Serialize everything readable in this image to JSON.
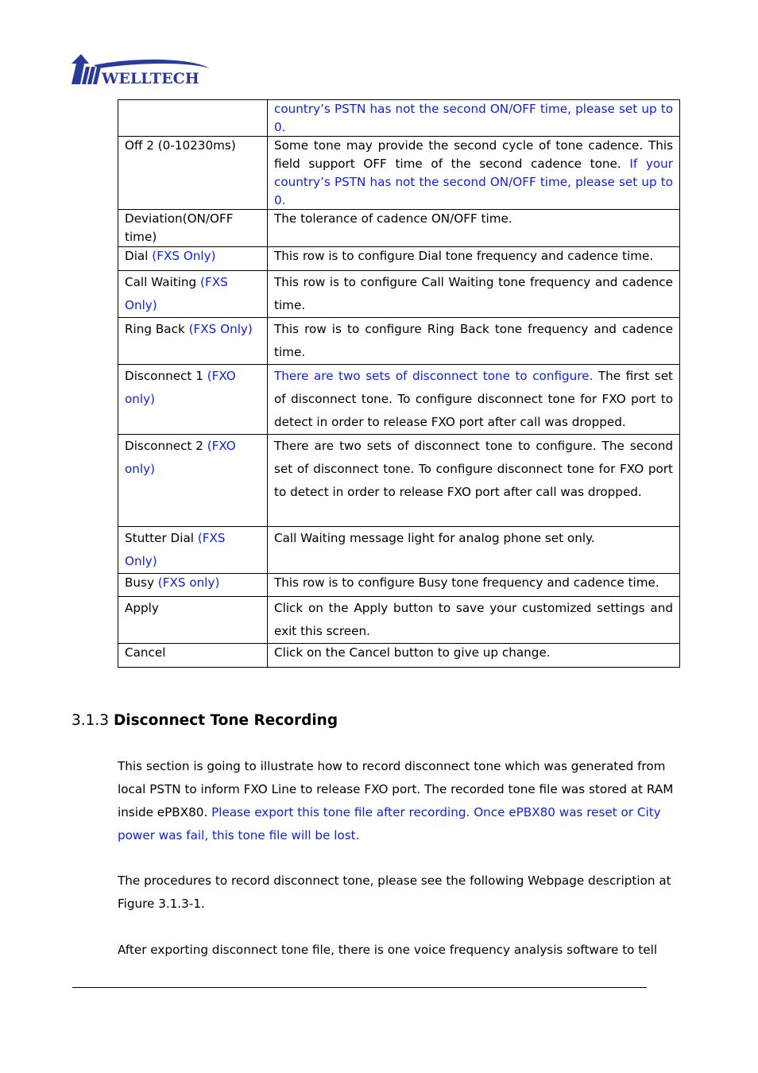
{
  "header": {
    "logo_text": "WELLTECH",
    "brand_color": "#2a3a9a"
  },
  "colors": {
    "highlight": "#0b1ff0",
    "text": "#000000"
  },
  "table": {
    "rows": [
      {
        "field": "",
        "field_note": "",
        "desc_plain": "",
        "desc_blue": "country’s PSTN has not the second ON/OFF time, please set up to 0.",
        "desc_after": ""
      },
      {
        "field": "Off 2 (0-10230ms)",
        "field_note": "",
        "desc_plain": "Some tone may provide the second cycle of tone cadence. This field support OFF time of the second cadence tone. ",
        "desc_blue": "If your country’s PSTN has not the second ON/OFF time, please set up to 0.",
        "desc_after": ""
      },
      {
        "field": "Deviation(ON/OFF time)",
        "field_note": "",
        "desc_plain": "The tolerance of cadence ON/OFF time.",
        "desc_blue": "",
        "desc_after": ""
      },
      {
        "field": "Dial ",
        "field_note": "(FXS Only)",
        "desc_plain": "This row is to configure Dial tone frequency and cadence time.",
        "desc_blue": "",
        "desc_after": ""
      },
      {
        "field": "Call Waiting ",
        "field_note": "(FXS Only)",
        "desc_plain": "This row is to configure Call Waiting tone frequency and cadence time.",
        "desc_blue": "",
        "desc_after": ""
      },
      {
        "field": "Ring Back ",
        "field_note": "(FXS Only)",
        "desc_plain": "This row is to configure Ring Back tone frequency and cadence time.",
        "desc_blue": "",
        "desc_after": ""
      },
      {
        "field": "Disconnect 1 ",
        "field_note": "(FXO only)",
        "desc_plain": "",
        "desc_blue": "There are two sets of disconnect tone to configure.",
        "desc_after": " The first set of disconnect tone. To configure disconnect tone for FXO port to detect in order to release FXO port after call was dropped."
      },
      {
        "field": "Disconnect 2 ",
        "field_note": "(FXO only)",
        "desc_plain": "There are two sets of disconnect tone to configure. The second set of disconnect tone. To configure disconnect tone for FXO port to detect in order to release FXO port after call was dropped.",
        "desc_blue": "",
        "desc_after": ""
      },
      {
        "field": "Stutter Dial ",
        "field_note": "(FXS Only)",
        "desc_plain": "Call Waiting message light for analog phone set only.",
        "desc_blue": "",
        "desc_after": ""
      },
      {
        "field": "Busy ",
        "field_note": "(FXS only)",
        "desc_plain": "This row is to configure Busy tone frequency and cadence time.",
        "desc_blue": "",
        "desc_after": ""
      },
      {
        "field": "Apply",
        "field_note": "",
        "desc_plain": "Click on the Apply button to save your customized settings and exit this screen.",
        "desc_blue": "",
        "desc_after": ""
      },
      {
        "field": "Cancel",
        "field_note": "",
        "desc_plain": "Click on the Cancel button to give up change.",
        "desc_blue": "",
        "desc_after": ""
      }
    ]
  },
  "section": {
    "number": "3.1.3 ",
    "title": "Disconnect Tone Recording",
    "p1_plain": "This section is going to illustrate how to record disconnect tone which was generated from local PSTN to inform FXO Line to release FXO port. The recorded tone file was stored at RAM inside ePBX80. ",
    "p1_blue": "Please export this tone file after recording. Once ePBX80 was reset or City power was fail, this tone file will be lost.",
    "p2": "The procedures to record disconnect tone, please see the following Webpage description at Figure 3.1.3-1.",
    "p3": "After exporting disconnect tone file, there is one voice frequency analysis software to tell"
  }
}
